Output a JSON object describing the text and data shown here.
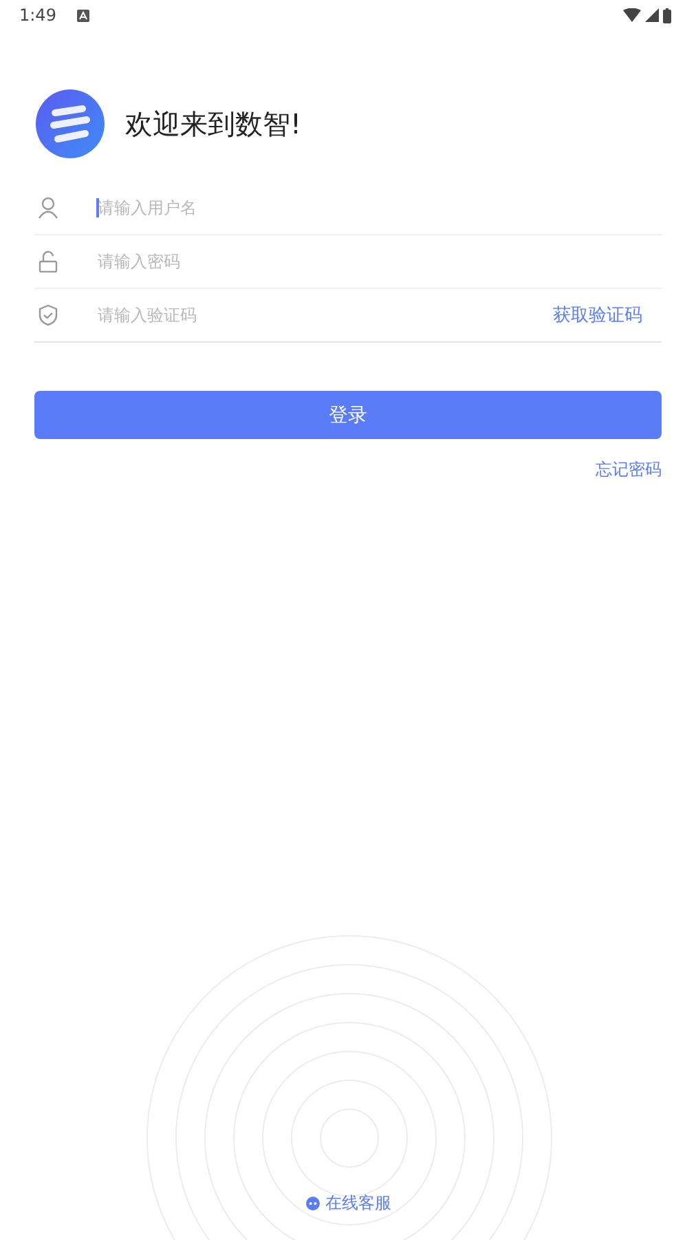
{
  "status_bar": {
    "time": "1:49"
  },
  "header": {
    "title": "欢迎来到数智!"
  },
  "fields": [
    {
      "kind": "user",
      "placeholder": "请输入用户名",
      "focused": true
    },
    {
      "kind": "lock",
      "placeholder": "请输入密码",
      "focused": false
    },
    {
      "kind": "shield",
      "placeholder": "请输入验证码",
      "focused": false,
      "action": "获取验证码"
    }
  ],
  "login_button": "登录",
  "forgot_link": "忘记密码",
  "support_link": "在线客服"
}
